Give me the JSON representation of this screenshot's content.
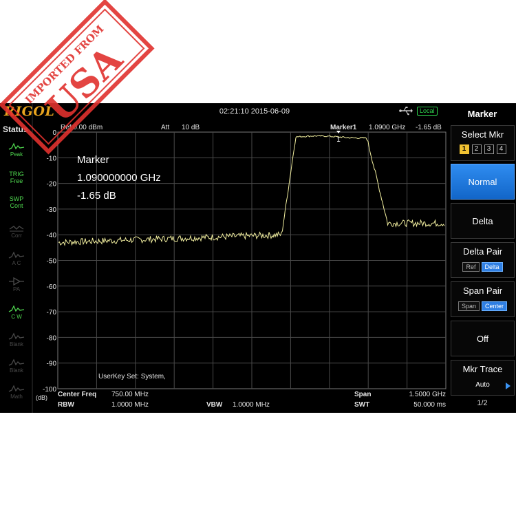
{
  "stamp": {
    "text_top": "IMPORTED FROM",
    "text_big": "USA",
    "color": "#e0312e"
  },
  "header": {
    "brand": "RIGOL",
    "datetime": "02:21:10 2015-06-09",
    "usb_icon": "usb-icon",
    "remote_status": "Local"
  },
  "status": {
    "title": "Status",
    "items": [
      {
        "label": "Peak",
        "icon": "peak-wave-icon",
        "state": "active"
      },
      {
        "line1": "TRIG",
        "line2": "Free",
        "state": "active"
      },
      {
        "line1": "SWP",
        "line2": "Cont",
        "state": "active"
      },
      {
        "label": "Corr",
        "icon": "corr-icon",
        "state": "inactive"
      },
      {
        "label": "A C",
        "icon": "ac-wave-icon",
        "state": "inactive"
      },
      {
        "label": "PA",
        "icon": "pa-icon",
        "state": "inactive"
      },
      {
        "label": "C W",
        "icon": "cw-wave-icon",
        "state": "active"
      },
      {
        "label": "Blank",
        "icon": "blank-wave-icon",
        "state": "inactive"
      },
      {
        "label": "Blank",
        "icon": "blank-wave-icon",
        "state": "inactive"
      },
      {
        "label": "Math",
        "icon": "math-wave-icon",
        "state": "inactive"
      }
    ]
  },
  "info": {
    "ref": "Ref  0.00 dBm",
    "att_label": "Att",
    "att_value": "10 dB",
    "marker_label": "Marker1",
    "marker_freq": "1.0900 GHz",
    "marker_amp": "-1.65 dB"
  },
  "readout": {
    "title": "Marker",
    "freq": "1.090000000 GHz",
    "amp": "-1.65 dB"
  },
  "plot": {
    "y_ticks": [
      "0",
      "-10",
      "-20",
      "-30",
      "-40",
      "-50",
      "-60",
      "-70",
      "-80",
      "-90",
      "-100"
    ],
    "unit": "(dB)",
    "marker_number": "1",
    "userkey": "UserKey Set:   System,",
    "trace_color": "#f3f0a0",
    "grid_color": "#4a4a4a",
    "ylim": [
      -100,
      0
    ]
  },
  "params": {
    "center_label": "Center Freq",
    "center_value": "750.00 MHz",
    "rbw_label": "RBW",
    "rbw_value": "1.0000 MHz",
    "vbw_label": "VBW",
    "vbw_value": "1.0000 MHz",
    "span_label": "Span",
    "span_value": "1.5000 GHz",
    "swt_label": "SWT",
    "swt_value": "50.000 ms"
  },
  "menu": {
    "title": "Marker",
    "select_mkr": {
      "label": "Select Mkr",
      "options": [
        "1",
        "2",
        "3",
        "4"
      ],
      "selected": "1"
    },
    "normal": "Normal",
    "delta": "Delta",
    "delta_pair": {
      "label": "Delta Pair",
      "options": [
        "Ref",
        "Delta"
      ],
      "selected": "Delta"
    },
    "span_pair": {
      "label": "Span Pair",
      "options": [
        "Span",
        "Center"
      ],
      "selected": "Center"
    },
    "off": "Off",
    "mkr_trace": {
      "label": "Mkr Trace",
      "value": "Auto"
    },
    "page": "1/2",
    "accent_color": "#2f8cf0"
  }
}
